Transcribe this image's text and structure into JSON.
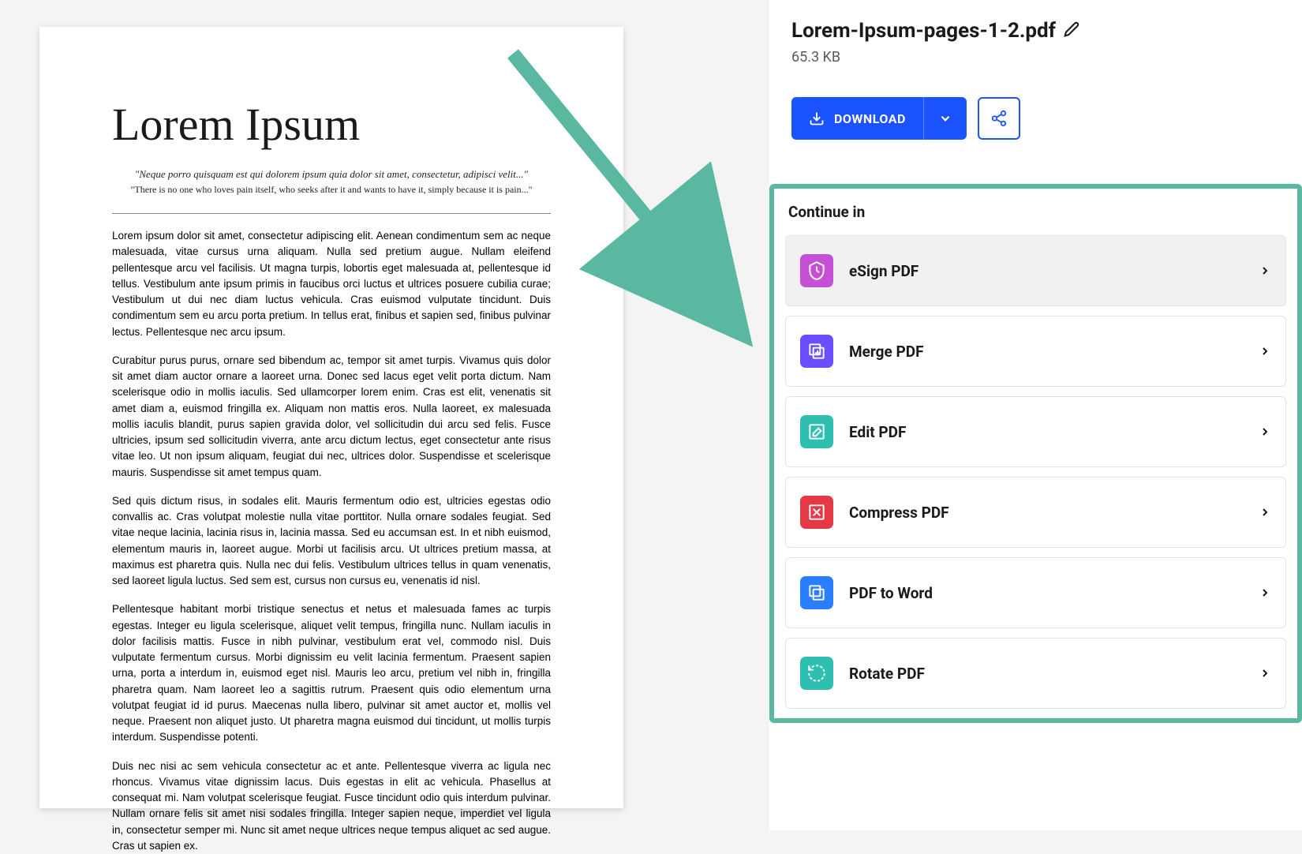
{
  "file": {
    "name": "Lorem-Ipsum-pages-1-2.pdf",
    "size": "65.3 KB"
  },
  "actions": {
    "download_label": "DOWNLOAD"
  },
  "continue": {
    "title": "Continue in",
    "tools": [
      {
        "label": "eSign PDF",
        "icon": "esign-icon",
        "color": "#c550d6",
        "active": true
      },
      {
        "label": "Merge PDF",
        "icon": "merge-icon",
        "color": "#6b4eff",
        "active": false
      },
      {
        "label": "Edit PDF",
        "icon": "edit-icon",
        "color": "#2ebfb0",
        "active": false
      },
      {
        "label": "Compress PDF",
        "icon": "compress-icon",
        "color": "#e63946",
        "active": false
      },
      {
        "label": "PDF to Word",
        "icon": "pdf-to-word-icon",
        "color": "#2b7fff",
        "active": false
      },
      {
        "label": "Rotate PDF",
        "icon": "rotate-icon",
        "color": "#2ebfb0",
        "active": false
      }
    ]
  },
  "document": {
    "title": "Lorem Ipsum",
    "quote": "\"Neque porro quisquam est qui dolorem ipsum quia dolor sit amet, consectetur, adipisci velit...\"",
    "subquote": "\"There is no one who loves pain itself, who seeks after it and wants to have it, simply because it is pain...\"",
    "paragraphs": [
      "Lorem ipsum dolor sit amet, consectetur adipiscing elit. Aenean condimentum sem ac neque malesuada, vitae cursus urna aliquam. Nulla sed pretium augue. Nullam eleifend pellentesque arcu vel facilisis. Ut magna turpis, lobortis eget malesuada at, pellentesque id tellus. Vestibulum ante ipsum primis in faucibus orci luctus et ultrices posuere cubilia curae; Vestibulum ut dui nec diam luctus vehicula. Cras euismod vulputate tincidunt. Duis condimentum sem eu arcu porta pretium. In tellus erat, finibus et sapien sed, finibus pulvinar lectus. Pellentesque nec arcu ipsum.",
      "Curabitur purus purus, ornare sed bibendum ac, tempor sit amet turpis. Vivamus quis dolor sit amet diam auctor ornare a laoreet urna. Donec sed lacus eget velit porta dictum. Nam scelerisque odio in mollis iaculis. Sed ullamcorper lorem enim. Cras est elit, venenatis sit amet diam a, euismod fringilla ex. Aliquam non mattis eros. Nulla laoreet, ex malesuada mollis iaculis blandit, purus sapien gravida dolor, vel sollicitudin dui arcu sed felis. Fusce ultricies, ipsum sed sollicitudin viverra, ante arcu dictum lectus, eget consectetur ante risus vitae leo. Ut non ipsum aliquam, feugiat dui nec, ultrices dolor. Suspendisse et scelerisque mauris. Suspendisse sit amet tempus quam.",
      "Sed quis dictum risus, in sodales elit. Mauris fermentum odio est, ultricies egestas odio convallis ac. Cras volutpat molestie nulla vitae porttitor. Nulla ornare sodales feugiat. Sed vitae neque lacinia, lacinia risus in, lacinia massa. Sed eu accumsan est. In et nibh euismod, elementum mauris in, laoreet augue. Morbi ut facilisis arcu. Ut ultrices pretium massa, at maximus est pharetra quis. Nulla nec dui felis. Vestibulum ultrices tellus in quam venenatis, sed laoreet ligula luctus. Sed sem est, cursus non cursus eu, venenatis id nisl.",
      "Pellentesque habitant morbi tristique senectus et netus et malesuada fames ac turpis egestas. Integer eu ligula scelerisque, aliquet velit tempus, fringilla nunc. Nullam iaculis in dolor facilisis mattis. Fusce in nibh pulvinar, vestibulum erat vel, commodo nisl. Duis vulputate fermentum cursus. Morbi dignissim eu velit lacinia fermentum. Praesent sapien urna, porta a interdum in, euismod eget nisl. Mauris leo arcu, pretium vel nibh in, fringilla pharetra quam. Nam laoreet leo a sagittis rutrum. Praesent quis odio elementum urna volutpat feugiat id id purus. Maecenas nulla libero, pulvinar sit amet auctor et, mollis vel neque. Praesent non aliquet justo. Ut pharetra magna euismod dui tincidunt, ut mollis turpis interdum. Suspendisse potenti.",
      "Duis nec nisi ac sem vehicula consectetur ac et ante. Pellentesque viverra ac ligula nec rhoncus. Vivamus vitae dignissim lacus. Duis egestas in elit ac vehicula. Phasellus at consequat mi. Nam volutpat scelerisque feugiat. Fusce tincidunt odio quis interdum pulvinar. Nullam ornare felis sit amet nisi sodales fringilla. Integer sapien neque, imperdiet vel ligula in, consectetur semper mi. Nunc sit amet neque ultrices neque tempus aliquet ac sed augue. Cras ut sapien ex."
    ]
  }
}
